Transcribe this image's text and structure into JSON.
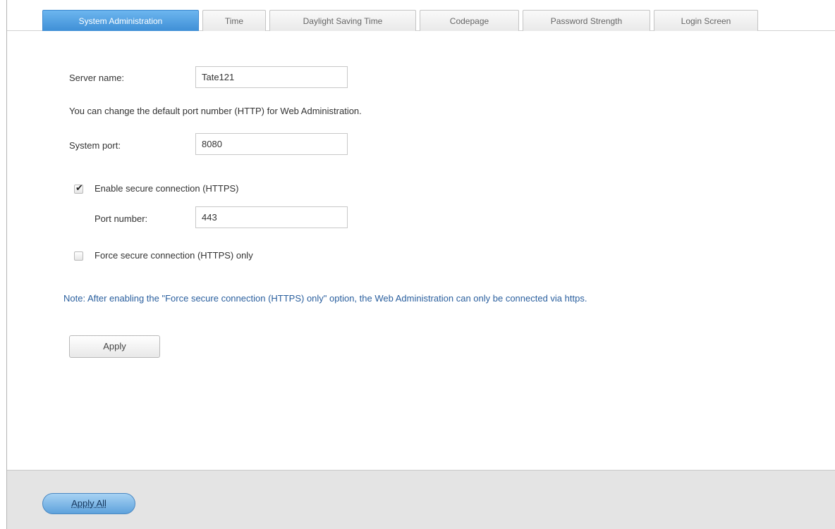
{
  "tabs": [
    {
      "label": "System Administration",
      "active": true
    },
    {
      "label": "Time",
      "active": false
    },
    {
      "label": "Daylight Saving Time",
      "active": false
    },
    {
      "label": "Codepage",
      "active": false
    },
    {
      "label": "Password Strength",
      "active": false
    },
    {
      "label": "Login Screen",
      "active": false
    }
  ],
  "form": {
    "server_name_label": "Server name:",
    "server_name_value": "Tate121",
    "port_info": "You can change the default port number (HTTP) for Web Administration.",
    "system_port_label": "System port:",
    "system_port_value": "8080",
    "https_checkbox_label": "Enable secure connection (HTTPS)",
    "https_checked": true,
    "port_number_label": "Port number:",
    "port_number_value": "443",
    "force_https_label": "Force secure connection (HTTPS) only",
    "force_https_checked": false,
    "note": "Note: After enabling the \"Force secure connection (HTTPS) only\" option, the Web Administration can only be connected via https.",
    "apply_label": "Apply"
  },
  "footer": {
    "apply_all_label": "Apply All"
  },
  "colors": {
    "active_tab": "#4a9de0",
    "note_text": "#2a5f9e",
    "footer_bg": "#e4e4e4"
  }
}
